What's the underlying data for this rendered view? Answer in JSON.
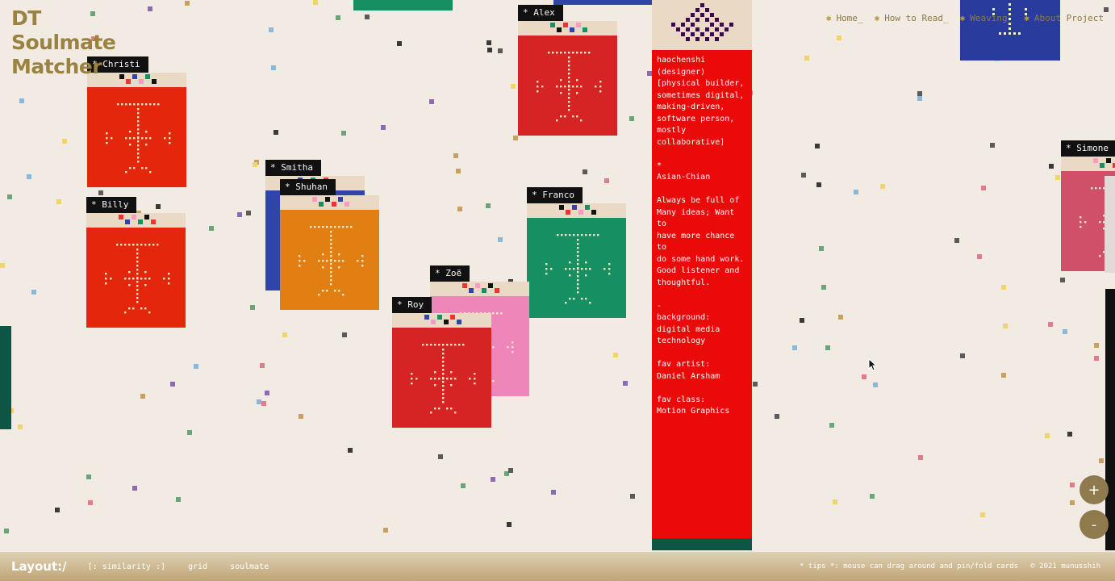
{
  "brand": {
    "line1": "DT",
    "line2": "Soulmate",
    "line3": "Matcher"
  },
  "nav": [
    {
      "label": "Home_"
    },
    {
      "label": "How to Read_"
    },
    {
      "label": "Weaving_"
    },
    {
      "label": "About Project"
    }
  ],
  "cards": [
    {
      "name": "Christi",
      "color": "#e3260c"
    },
    {
      "name": "Billy",
      "color": "#e3260c"
    },
    {
      "name": "Smitha",
      "color": "#2f45a8"
    },
    {
      "name": "Shuhan",
      "color": "#e27f12"
    },
    {
      "name": "Alex",
      "color": "#d62323"
    },
    {
      "name": "Franco",
      "color": "#169063"
    },
    {
      "name": "Zoë",
      "color": "#ef86b9"
    },
    {
      "name": "Roy",
      "color": "#d62323"
    },
    {
      "name": "Simone",
      "color": "#cf5068"
    }
  ],
  "detail": {
    "name": "haochenshi",
    "text": "haochenshi\n(designer)\n[physical builder,\nsometimes digital,\nmaking-driven,\nsoftware person,\nmostly\ncollaborative]\n\n*\nAsian-Chian\n\nAlways be full of\nMany ideas; Want to\nhave more chance to\ndo some hand work.\nGood listener and\nthoughtful.\n\n-\nbackground:\ndigital media\ntechnology\n\nfav artist:\nDaniel Arsham\n\nfav class:\nMotion Graphics"
  },
  "bottom": {
    "layout_title": "Layout:/",
    "options": [
      "[: similarity :]",
      "grid",
      "soulmate"
    ],
    "tip": "* tips *: mouse can drag around and pin/fold cards",
    "copyright": "© 2021 munusshih"
  },
  "zoom": {
    "in": "+",
    "out": "-"
  },
  "colors": {
    "background": "#f1ebe3",
    "brand": "#9a8240",
    "detail_red": "#ea0a0a",
    "bar": "#bfa575"
  }
}
